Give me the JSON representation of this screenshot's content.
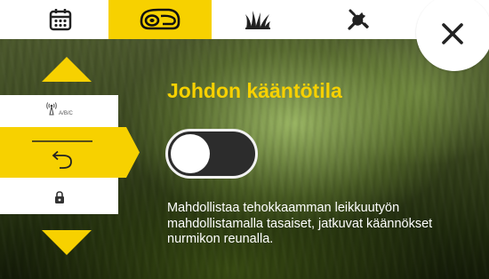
{
  "header": {
    "tabs": [
      {
        "icon": "calendar-icon",
        "active": false
      },
      {
        "icon": "robot-mower-icon",
        "active": true
      },
      {
        "icon": "grass-icon",
        "active": false
      },
      {
        "icon": "tools-icon",
        "active": false
      }
    ],
    "close_icon": "close-icon"
  },
  "sidebar": {
    "up_icon": "arrow-up-icon",
    "down_icon": "arrow-down-icon",
    "items": [
      {
        "icon": "signal-antenna-icon",
        "label": "A/B/C"
      },
      {
        "icon": "turn-back-icon",
        "selected": true
      },
      {
        "icon": "lock-icon"
      }
    ]
  },
  "main": {
    "title": "Johdon kääntötila",
    "toggle_on": false,
    "description": "Mahdollistaa tehokkaamman leikkuutyön mahdollistamalla tasaiset, jatkuvat käännökset nurmikon reunalla."
  },
  "colors": {
    "accent": "#f7d100",
    "background": "#3a4620",
    "bar": "#ffffff"
  }
}
